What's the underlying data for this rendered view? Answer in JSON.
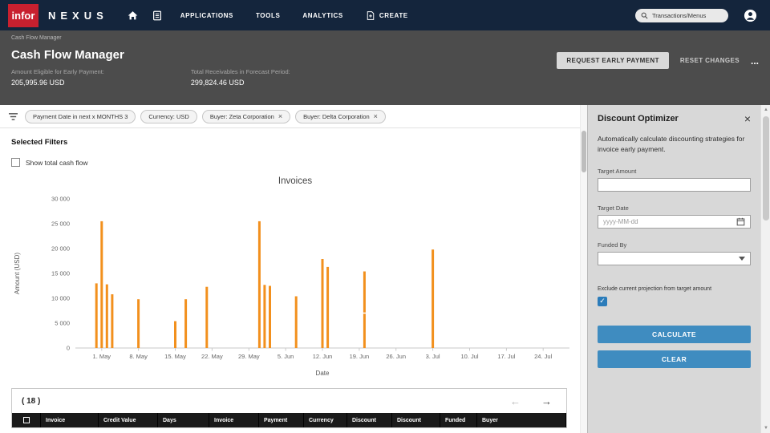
{
  "topnav": {
    "logo_text": "infor",
    "brand": "NEXUS",
    "items": [
      {
        "label": "APPLICATIONS"
      },
      {
        "label": "TOOLS"
      },
      {
        "label": "ANALYTICS"
      },
      {
        "label": "CREATE"
      }
    ],
    "search_value": "Transactions/Menus"
  },
  "breadcrumb": "Cash Flow Manager",
  "header": {
    "title": "Cash Flow Manager",
    "request_early_payment": "REQUEST EARLY PAYMENT",
    "reset_changes": "RESET CHANGES",
    "more": "...",
    "stats": [
      {
        "label": "Amount Eligible for Early Payment:",
        "value": "205,995.96 USD"
      },
      {
        "label": "Total Receivables in Forecast Period:",
        "value": "299,824.46 USD"
      }
    ]
  },
  "filters": {
    "chips": [
      {
        "label": "Payment Date in next x MONTHS 3",
        "closable": false
      },
      {
        "label": "Currency: USD",
        "closable": false
      },
      {
        "label": "Buyer: Zeta Corporation",
        "closable": true
      },
      {
        "label": "Buyer: Delta Corporation",
        "closable": true
      }
    ]
  },
  "main": {
    "selected_filters_title": "Selected Filters",
    "show_total_cash_flow_label": "Show total cash flow",
    "pager_count": "( 18 )"
  },
  "chart_data": {
    "type": "bar",
    "title": "Invoices",
    "xlabel": "Date",
    "ylabel": "Amount (USD)",
    "ylim": [
      0,
      30000
    ],
    "ytick_step": 5000,
    "ytick_labels": [
      "0",
      "5 000",
      "10 000",
      "15 000",
      "20 000",
      "25 000",
      "30 000"
    ],
    "xtick_labels": [
      "1. May",
      "8. May",
      "15. May",
      "22. May",
      "29. May",
      "5. Jun",
      "12. Jun",
      "19. Jun",
      "26. Jun",
      "3. Jul",
      "10. Jul",
      "17. Jul",
      "24. Jul"
    ],
    "xtick_days": [
      0,
      7,
      14,
      21,
      28,
      35,
      42,
      49,
      56,
      63,
      70,
      77,
      84
    ],
    "x_range_days": [
      -5,
      89
    ],
    "grid": false,
    "bar_color": "#f2901d",
    "bars": [
      {
        "date": "Apr 30",
        "day": -1,
        "segments": [
          13000
        ]
      },
      {
        "date": "May 1",
        "day": 0,
        "segments": [
          25500
        ]
      },
      {
        "date": "May 2",
        "day": 1,
        "segments": [
          12800
        ]
      },
      {
        "date": "May 3",
        "day": 2,
        "segments": [
          10800
        ]
      },
      {
        "date": "May 8",
        "day": 7,
        "segments": [
          9800
        ]
      },
      {
        "date": "May 15",
        "day": 14,
        "segments": [
          5400
        ]
      },
      {
        "date": "May 17",
        "day": 16,
        "segments": [
          9800
        ]
      },
      {
        "date": "May 21",
        "day": 20,
        "segments": [
          12300
        ]
      },
      {
        "date": "May 31",
        "day": 30,
        "segments": [
          25500
        ]
      },
      {
        "date": "Jun 1",
        "day": 31,
        "segments": [
          12700
        ]
      },
      {
        "date": "Jun 2",
        "day": 32,
        "segments": [
          12500
        ]
      },
      {
        "date": "Jun 7",
        "day": 37,
        "segments": [
          10400
        ]
      },
      {
        "date": "Jun 12",
        "day": 42,
        "segments": [
          17900
        ]
      },
      {
        "date": "Jun 13",
        "day": 43,
        "segments": [
          16300
        ]
      },
      {
        "date": "Jun 20",
        "day": 50,
        "segments": [
          6900,
          8500
        ]
      },
      {
        "date": "Jul 3",
        "day": 63,
        "segments": [
          19800
        ]
      }
    ]
  },
  "table": {
    "columns": [
      "Invoice",
      "Credit Value",
      "Days",
      "Invoice",
      "Payment",
      "Currency",
      "Discount",
      "Discount",
      "Funded",
      "Buyer"
    ]
  },
  "optimizer": {
    "title": "Discount Optimizer",
    "description": "Automatically calculate discounting strategies for invoice early payment.",
    "target_amount_label": "Target Amount",
    "target_amount_value": "",
    "target_date_label": "Target Date",
    "target_date_placeholder": "yyyy-MM-dd",
    "funded_by_label": "Funded By",
    "funded_by_value": "",
    "exclude_label": "Exclude current projection from target amount",
    "exclude_checked": true,
    "calculate_button": "CALCULATE",
    "clear_button": "CLEAR"
  },
  "colors": {
    "accent_blue": "#3f8cc0",
    "bar_orange": "#f2901d",
    "infor_red": "#c8202f",
    "checkbox_blue": "#2b7cba",
    "nav_navy": "#14253c"
  }
}
